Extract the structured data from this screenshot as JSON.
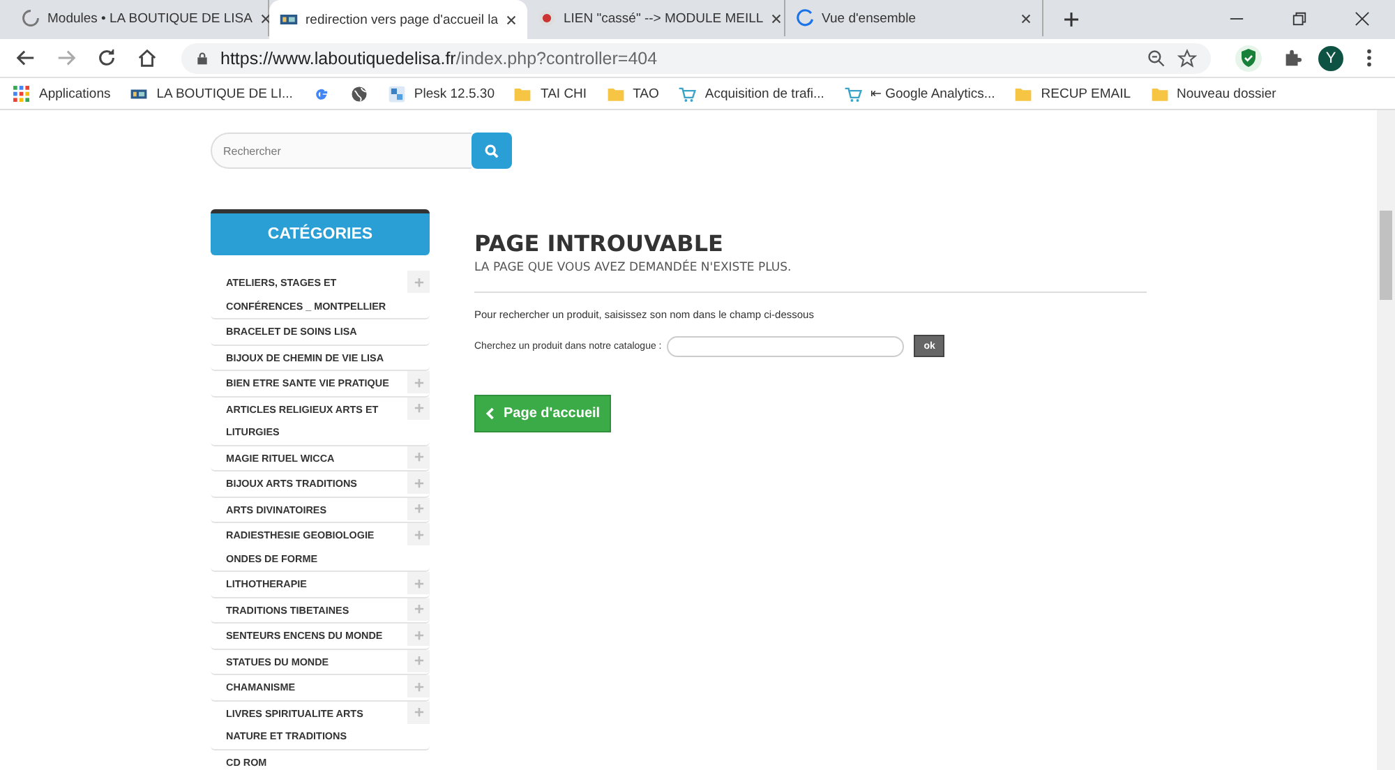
{
  "tabs": [
    {
      "title": "Modules • LA BOUTIQUE DE LISA",
      "kind": "loading",
      "selected": false
    },
    {
      "title": "redirection vers page d'accueil la",
      "kind": "site",
      "selected": true
    },
    {
      "title": "LIEN \"cassé\" --> MODULE MEILL",
      "kind": "forum",
      "selected": false
    },
    {
      "title": "Vue d'ensemble",
      "kind": "arc",
      "selected": false
    }
  ],
  "address": {
    "url_main": "https://www.laboutiquedelisa.fr",
    "url_rest": "/index.php?controller=404"
  },
  "profile": {
    "initial": "Y"
  },
  "bookmarks": [
    {
      "label": "Applications",
      "kind": "apps"
    },
    {
      "label": "LA BOUTIQUE DE LI...",
      "kind": "site"
    },
    {
      "kind": "google"
    },
    {
      "kind": "globe"
    },
    {
      "label": "Plesk 12.5.30",
      "kind": "plesk"
    },
    {
      "label": "TAI CHI",
      "kind": "folder"
    },
    {
      "label": "TAO",
      "kind": "folder"
    },
    {
      "label": "Acquisition de trafi...",
      "kind": "cart"
    },
    {
      "label": "⇤ Google Analytics...",
      "kind": "cart"
    },
    {
      "label": "RECUP EMAIL",
      "kind": "folder"
    },
    {
      "label": "Nouveau dossier",
      "kind": "folder"
    }
  ],
  "search": {
    "placeholder": "Rechercher"
  },
  "categories": {
    "title": "CATÉGORIES",
    "items": [
      {
        "label": "ATELIERS, STAGES ET CONFÉRENCES _ MONTPELLIER",
        "expandable": true
      },
      {
        "label": "BRACELET DE SOINS LISA",
        "expandable": false
      },
      {
        "label": "BIJOUX DE CHEMIN DE VIE LISA",
        "expandable": false
      },
      {
        "label": "BIEN ETRE SANTE VIE PRATIQUE",
        "expandable": true
      },
      {
        "label": "ARTICLES RELIGIEUX ARTS ET LITURGIES",
        "expandable": true
      },
      {
        "label": "MAGIE RITUEL WICCA",
        "expandable": true
      },
      {
        "label": "BIJOUX ARTS TRADITIONS",
        "expandable": true
      },
      {
        "label": "ARTS DIVINATOIRES",
        "expandable": true
      },
      {
        "label": "RADIESTHESIE GEOBIOLOGIE ONDES DE FORME",
        "expandable": true
      },
      {
        "label": "LITHOTHERAPIE",
        "expandable": true
      },
      {
        "label": "TRADITIONS TIBETAINES",
        "expandable": true
      },
      {
        "label": "SENTEURS ENCENS DU MONDE",
        "expandable": true
      },
      {
        "label": "STATUES DU MONDE",
        "expandable": true
      },
      {
        "label": "CHAMANISME",
        "expandable": true
      },
      {
        "label": "LIVRES SPIRITUALITE ARTS NATURE ET TRADITIONS",
        "expandable": true
      },
      {
        "label": "CD ROM",
        "expandable": false
      }
    ]
  },
  "main": {
    "heading": "PAGE INTROUVABLE",
    "subheading": "LA PAGE QUE VOUS AVEZ DEMANDÉE N'EXISTE PLUS.",
    "hint": "Pour rechercher un produit, saisissez son nom dans le champ ci-dessous",
    "search_label": "Cherchez un produit dans notre catalogue :",
    "search_button": "ok",
    "home_button": "Page d'accueil"
  }
}
